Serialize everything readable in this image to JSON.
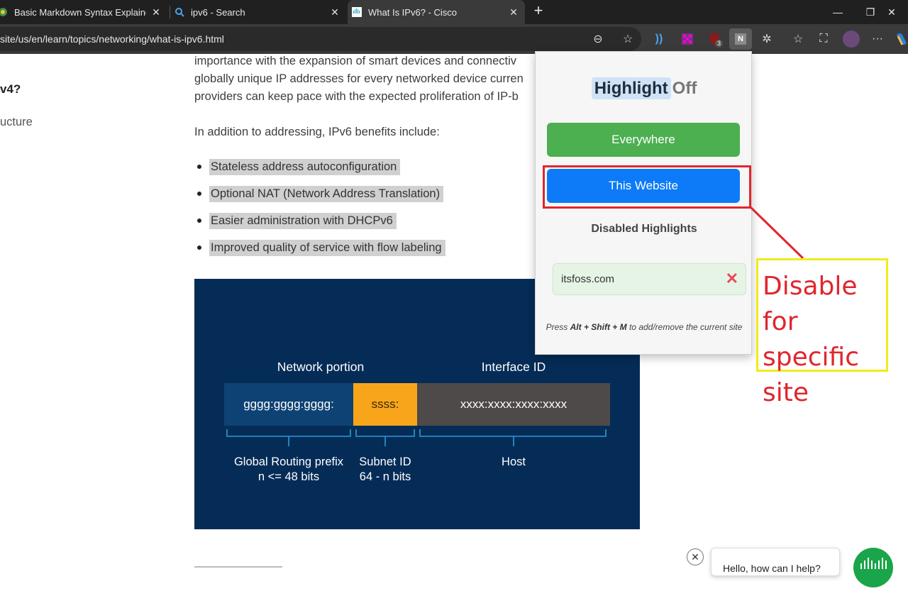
{
  "browser": {
    "tabs": [
      {
        "title": "Basic Markdown Syntax Explained",
        "icon": "earth-icon"
      },
      {
        "title": "ipv6 - Search",
        "icon": "search-icon"
      },
      {
        "title": "What Is IPv6? - Cisco",
        "icon": "cisco-icon",
        "active": true
      }
    ],
    "url": "site/us/en/learn/topics/networking/what-is-ipv6.html",
    "extension_badge": "3",
    "extension_letter": "N"
  },
  "sidebar": {
    "item_a": "v4?",
    "item_b": "ucture"
  },
  "article": {
    "lines": [
      "importance with the expansion of smart devices and connectiv",
      "globally unique IP addresses for every networked device curren",
      "providers can keep pace with the expected proliferation of IP-b"
    ],
    "benefits_intro": "In addition to addressing, IPv6 benefits include:",
    "benefits": [
      "Stateless address autoconfiguration",
      "Optional NAT (Network Address Translation)",
      "Easier administration with DHCPv6",
      "Improved quality of service with flow labeling"
    ]
  },
  "diagram": {
    "network_portion": "Network portion",
    "interface_id": "Interface ID",
    "seg_global": "gggg:gggg:gggg:",
    "seg_subnet": "ssss:",
    "seg_host": "xxxx:xxxx:xxxx:xxxx",
    "label_global_1": "Global Routing prefix",
    "label_global_2": "n <= 48 bits",
    "label_subnet_1": "Subnet ID",
    "label_subnet_2": "64 - n bits",
    "label_host": "Host",
    "colors": {
      "background": "#052c57",
      "global": "#0e4274",
      "subnet": "#f8a51c",
      "host": "#4e4a49",
      "bracket": "#2b9ad9"
    }
  },
  "popup": {
    "title_highlight": "Highlight",
    "title_state": "Off",
    "btn_everywhere": "Everywhere",
    "btn_website": "This Website",
    "disabled_heading": "Disabled Highlights",
    "disabled_sites": [
      "itsfoss.com"
    ],
    "hint_prefix": "Press ",
    "hint_keys": "Alt + Shift + M",
    "hint_suffix": " to add/remove the current site"
  },
  "annotation": {
    "line1": "Disable for",
    "line2": "specific",
    "line3": "site"
  },
  "chat": {
    "text": "Hello, how can I help?"
  }
}
